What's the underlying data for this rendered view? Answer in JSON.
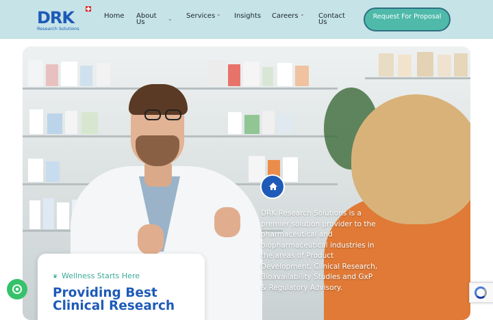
{
  "brand": {
    "logo_text": "DRK",
    "logo_sub": "Research Solutions"
  },
  "nav": {
    "items": [
      {
        "label": "Home",
        "has_dropdown": false
      },
      {
        "label": "About Us",
        "has_dropdown": true
      },
      {
        "label": "Services",
        "has_dropdown": true
      },
      {
        "label": "Insights",
        "has_dropdown": false
      },
      {
        "label": "Careers",
        "has_dropdown": true
      },
      {
        "label": "Contact Us",
        "has_dropdown": false
      }
    ],
    "cta_label": "Request For Proposal"
  },
  "hero": {
    "description": "DRK Research Solutions is a premier solution provider to the pharmaceutical and biopharmaceutical industries in the areas of Product Development, Clinical Research, Bioavailability Studies and GxP & Regulatory Advisory."
  },
  "card": {
    "tag": "Wellness Starts Here",
    "title": "Providing Best Clinical Research"
  },
  "icons": {
    "home": "home-icon",
    "whatsapp": "whatsapp-icon",
    "recaptcha": "recaptcha-icon",
    "leaf": "leaf-icon"
  },
  "colors": {
    "header_bg": "#c6e3e7",
    "brand_blue": "#1e5bb8",
    "accent_teal": "#4fb9aa",
    "whatsapp_green": "#35c26a"
  }
}
